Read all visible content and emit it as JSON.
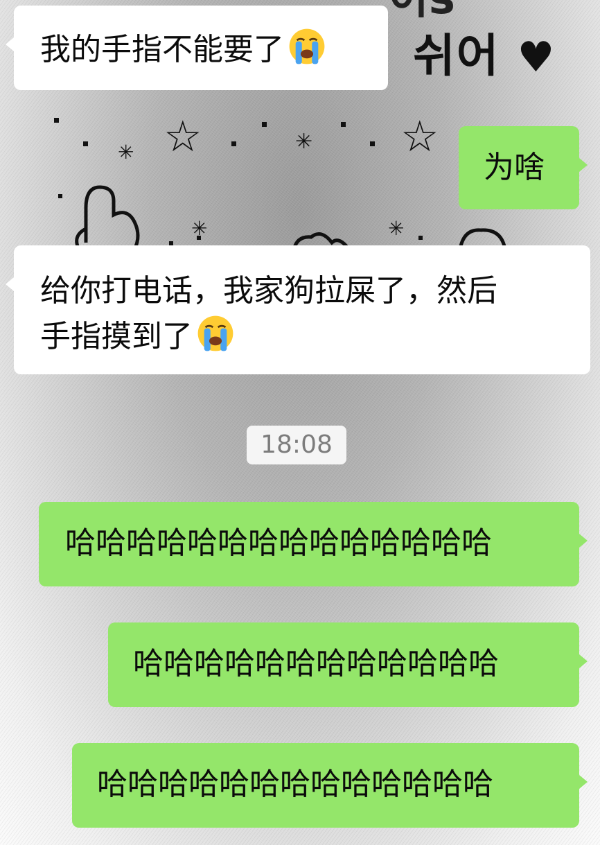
{
  "wallpaper": {
    "korean_text": "쉬어",
    "heart": "♥",
    "top_fragment": "이s",
    "stars": [
      "☆",
      "☆",
      "✳",
      "✳",
      "✳",
      "✳",
      "✦"
    ]
  },
  "messages": [
    {
      "side": "incoming",
      "text": "我的手指不能要了",
      "emoji": "loudly-crying-face"
    },
    {
      "side": "outgoing",
      "text": "为啥"
    },
    {
      "side": "incoming",
      "text_line1": "给你打电话，我家狗拉屎了，然后",
      "text_line2": "手指摸到了",
      "emoji": "loudly-crying-face"
    },
    {
      "side": "outgoing",
      "text": "哈哈哈哈哈哈哈哈哈哈哈哈哈哈"
    },
    {
      "side": "outgoing",
      "text": "哈哈哈哈哈哈哈哈哈哈哈哈"
    },
    {
      "side": "outgoing",
      "text": "哈哈哈哈哈哈哈哈哈哈哈哈哈"
    }
  ],
  "timestamp": "18:08",
  "colors": {
    "incoming_bubble": "#ffffff",
    "outgoing_bubble": "#94e66a",
    "timestamp_text": "#7c7c7c"
  }
}
